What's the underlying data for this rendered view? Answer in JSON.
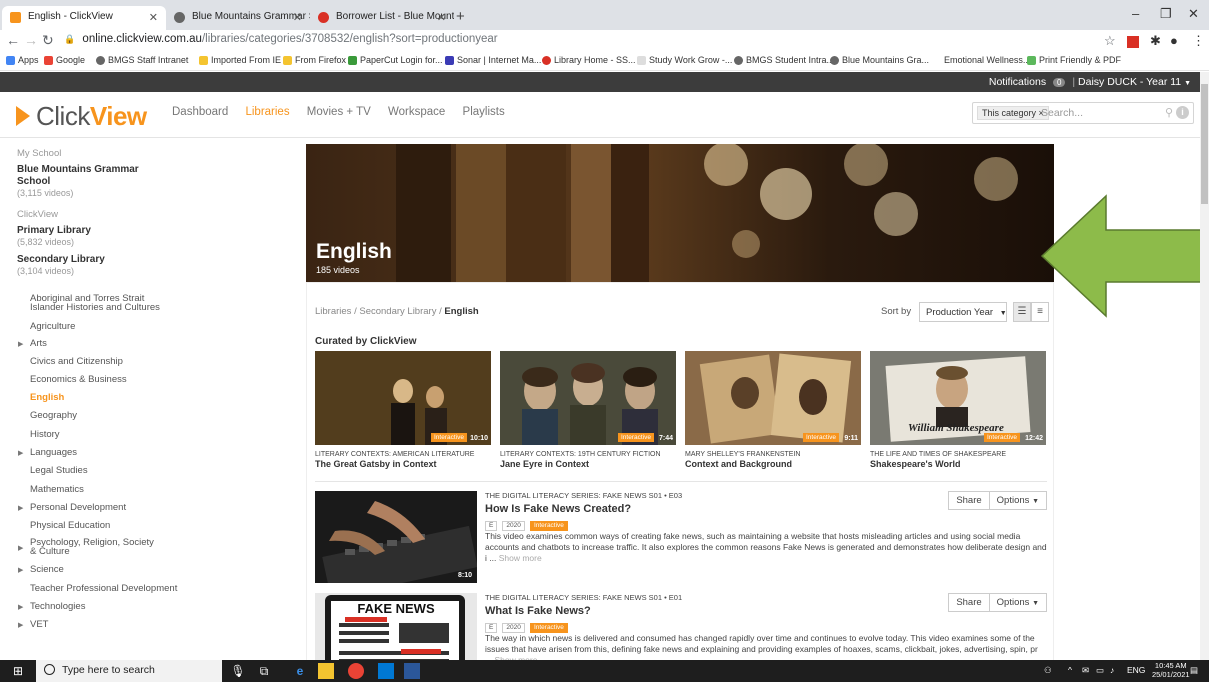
{
  "browser": {
    "tabs": [
      {
        "title": "English - ClickView",
        "color": "#f7941d"
      },
      {
        "title": "Blue Mountains Grammar School",
        "color": "#888888"
      },
      {
        "title": "Borrower List - Blue Mountains G",
        "color": "#d93025"
      }
    ],
    "address": {
      "host": "online.clickview.com.au",
      "path": "/libraries/categories/3708532/english?sort=productionyear"
    },
    "bookmarks": [
      "Apps",
      "Google",
      "BMGS Staff Intranet",
      "Imported From IE",
      "From Firefox",
      "PaperCut Login for...",
      "Sonar | Internet Ma...",
      "Library Home - SS...",
      "Study Work Grow -...",
      "BMGS Student Intra...",
      "Blue Mountains Gra...",
      "Emotional Wellness...",
      "Print Friendly & PDF"
    ]
  },
  "topbar": {
    "notifications_label": "Notifications",
    "notifications_count": "0",
    "user": "Daisy DUCK - Year 11"
  },
  "header": {
    "logo_click": "Click",
    "logo_view": "View",
    "nav": [
      "Dashboard",
      "Libraries",
      "Movies + TV",
      "Workspace",
      "Playlists"
    ],
    "search_chip": "This category ×",
    "search_placeholder": "Search..."
  },
  "sidebar": {
    "my_school_heading": "My School",
    "school_name": "Blue Mountains Grammar School",
    "school_count": "(3,115 videos)",
    "clickview_heading": "ClickView",
    "primary_label": "Primary Library",
    "primary_count": "(5,832 videos)",
    "secondary_label": "Secondary Library",
    "secondary_count": "(3,104 videos)",
    "categories": [
      {
        "label": "Aboriginal and Torres Strait Islander Histories and Cultures",
        "expandable": false
      },
      {
        "label": "Agriculture",
        "expandable": false
      },
      {
        "label": "Arts",
        "expandable": true
      },
      {
        "label": "Civics and Citizenship",
        "expandable": false
      },
      {
        "label": "Economics & Business",
        "expandable": false
      },
      {
        "label": "English",
        "expandable": false
      },
      {
        "label": "Geography",
        "expandable": false
      },
      {
        "label": "History",
        "expandable": false
      },
      {
        "label": "Languages",
        "expandable": true
      },
      {
        "label": "Legal Studies",
        "expandable": false
      },
      {
        "label": "Mathematics",
        "expandable": false
      },
      {
        "label": "Personal Development",
        "expandable": true
      },
      {
        "label": "Physical Education",
        "expandable": false
      },
      {
        "label": "Psychology, Religion, Society & Culture",
        "expandable": true
      },
      {
        "label": "Science",
        "expandable": true
      },
      {
        "label": "Teacher Professional Development",
        "expandable": false
      },
      {
        "label": "Technologies",
        "expandable": true
      },
      {
        "label": "VET",
        "expandable": true
      }
    ]
  },
  "hero": {
    "title": "English",
    "count": "185 videos"
  },
  "breadcrumb": {
    "a": "Libraries",
    "b": "Secondary Library",
    "c": "English",
    "sep": "/"
  },
  "sort": {
    "label": "Sort by",
    "value": "Production Year"
  },
  "curated": {
    "heading": "Curated by ClickView",
    "items": [
      {
        "series": "LITERARY CONTEXTS: AMERICAN LITERATURE",
        "title": "The Great Gatsby in Context",
        "tag": "Interactive",
        "duration": "10:10"
      },
      {
        "series": "LITERARY CONTEXTS: 19TH CENTURY FICTION",
        "title": "Jane Eyre in Context",
        "tag": "Interactive",
        "duration": "7:44"
      },
      {
        "series": "MARY SHELLEY'S FRANKENSTEIN",
        "title": "Context and Background",
        "tag": "Interactive",
        "duration": "9:11"
      },
      {
        "series": "THE LIFE AND TIMES OF SHAKESPEARE",
        "title": "Shakespeare's World",
        "tag": "Interactive",
        "duration": "12:42"
      }
    ]
  },
  "videos": [
    {
      "series": "THE DIGITAL LITERACY SERIES: FAKE NEWS  S01 • E03",
      "title": "How Is Fake News Created?",
      "rating": "E",
      "year": "2020",
      "tag": "Interactive",
      "duration": "8:10",
      "description": "This video examines common ways of creating fake news, such as maintaining a website that hosts misleading articles and using social media accounts and chatbots to increase traffic. It also explores the common reasons Fake News is generated and demonstrates how deliberate design and i ...",
      "more": "Show more",
      "share": "Share",
      "options": "Options"
    },
    {
      "series": "THE DIGITAL LITERACY SERIES: FAKE NEWS  S01 • E01",
      "title": "What Is Fake News?",
      "rating": "E",
      "year": "2020",
      "tag": "Interactive",
      "thumb_text": "FAKE NEWS",
      "description": "The way in which news is delivered and consumed has changed rapidly over time and continues to evolve today. This video examines some of the issues that have arisen from this, defining fake news and explaining and providing examples of hoaxes, scams, clickbait, jokes, advertising, spin, pr ...",
      "more": "Show more",
      "share": "Share",
      "options": "Options"
    }
  ],
  "taskbar": {
    "search_placeholder": "Type here to search",
    "lang": "ENG",
    "time": "10:45 AM",
    "date": "25/01/2021"
  },
  "colors": {
    "accent": "#f7941d",
    "arrow": "#8dbb4a"
  }
}
